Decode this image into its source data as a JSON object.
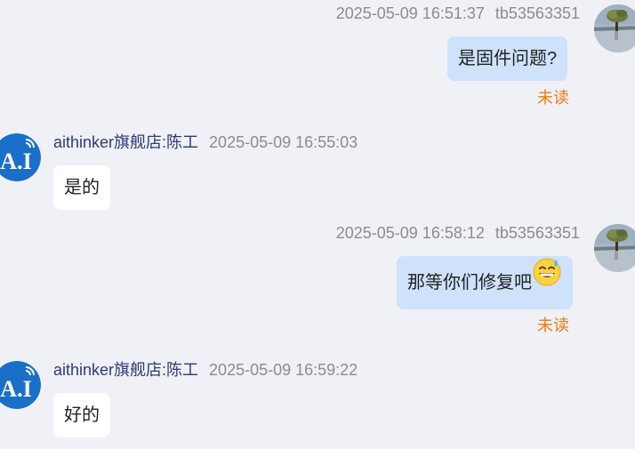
{
  "messages": [
    {
      "direction": "out",
      "time": "2025-05-09 16:51:37",
      "sender": "tb53563351",
      "text": "是固件问题?",
      "status": "未读"
    },
    {
      "direction": "in",
      "sender": "aithinker旗舰店:陈工",
      "time": "2025-05-09 16:55:03",
      "text": "是的"
    },
    {
      "direction": "out",
      "time": "2025-05-09 16:58:12",
      "sender": "tb53563351",
      "text": "那等你们修复吧",
      "emoji": "grinning-sweat-emoji",
      "status": "未读"
    },
    {
      "direction": "in",
      "sender": "aithinker旗舰店:陈工",
      "time": "2025-05-09 16:59:22",
      "text": "好的"
    }
  ],
  "colors": {
    "background": "#f0f1f6",
    "outgoing_bubble": "#cfe2fb",
    "incoming_bubble": "#ffffff",
    "unread": "#f07a12",
    "sender_name": "#2d3a78",
    "meta": "#8c8c8c",
    "brand_avatar": "#1a6fc9"
  }
}
